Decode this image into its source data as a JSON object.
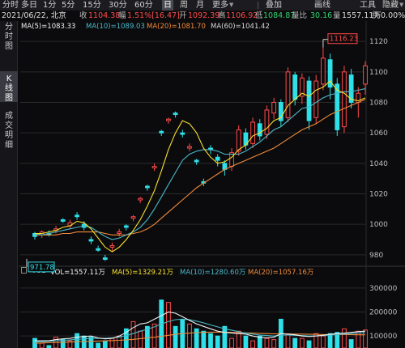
{
  "toolbar": {
    "items": [
      "分时",
      "多日",
      "1分",
      "5分",
      "15分",
      "30分",
      "60分",
      "日",
      "周",
      "月",
      "更多"
    ],
    "active_index": 7,
    "right_items": [
      "叠加",
      "画线",
      "工具",
      "隐藏"
    ]
  },
  "info": {
    "date_location": "2021/06/22, 北京",
    "close_label": "收",
    "close_value": "1104.38",
    "change_label": "幅",
    "change_value": "1.51%[16.47]",
    "open_label": "开",
    "open_value": "1092.39",
    "high_label": "高",
    "high_value": "1106.92",
    "low_label": "低",
    "low_value": "1084.87",
    "amp_label": "量比",
    "amp_value": "30.16",
    "amount_label": "量",
    "amount_value": "1557.11万",
    "turnover_label": "换",
    "turnover_value": "0.00%"
  },
  "sidebar": {
    "items": [
      "分时图",
      "K线图",
      "成交明细"
    ],
    "active_index": 1
  },
  "ma_legend": {
    "ma5": "MA(5)=1083.33",
    "ma10": "MA(10)=1089.03",
    "ma20": "MA(20)=1081.70",
    "ma60": "MA(60)=1041.42"
  },
  "vol_legend": {
    "vol_tag": "VOL",
    "vol": "VOL=1557.11万",
    "ma5": "MA(5)=1329.21万",
    "ma10": "MA(10)=1280.60万",
    "ma20": "MA(20)=1057.16万"
  },
  "colors": {
    "up": "#ff4a4a",
    "down": "#2ee0e8",
    "ma5": "#f0f0f0",
    "ma10": "#f7e12c",
    "ma20": "#4ab8c8",
    "ma60": "#f08a3a"
  },
  "chart_data": [
    {
      "type": "candlestick",
      "title": "",
      "y_ticks": [
        980,
        1000,
        1020,
        1040,
        1060,
        1080,
        1100,
        1120
      ],
      "ylim": [
        973,
        1127
      ],
      "annotations": [
        {
          "text": "1116.23",
          "kind": "high-marker"
        },
        {
          "text": "971.78",
          "kind": "low-marker"
        }
      ],
      "candles": [
        {
          "o": 994,
          "c": 992,
          "h": 995,
          "l": 990
        },
        {
          "o": 993,
          "c": 995,
          "h": 996,
          "l": 991
        },
        {
          "o": 994,
          "c": 993,
          "h": 996,
          "l": 992
        },
        {
          "o": 996,
          "c": 997,
          "h": 999,
          "l": 994
        },
        {
          "o": 1003,
          "c": 1002,
          "h": 1004,
          "l": 1001
        },
        {
          "o": 999,
          "c": 1001,
          "h": 1003,
          "l": 997
        },
        {
          "o": 1006,
          "c": 1005,
          "h": 1008,
          "l": 1003
        },
        {
          "o": 1000,
          "c": 998,
          "h": 1002,
          "l": 996
        },
        {
          "o": 990,
          "c": 989,
          "h": 992,
          "l": 987
        },
        {
          "o": 984,
          "c": 983,
          "h": 986,
          "l": 982
        },
        {
          "o": 978,
          "c": 977,
          "h": 980,
          "l": 976
        },
        {
          "o": 985,
          "c": 986,
          "h": 988,
          "l": 982
        },
        {
          "o": 994,
          "c": 995,
          "h": 997,
          "l": 992
        },
        {
          "o": 999,
          "c": 998,
          "h": 1000,
          "l": 996
        },
        {
          "o": 1004,
          "c": 1005,
          "h": 1006,
          "l": 1002
        },
        {
          "o": 1016,
          "c": 1017,
          "h": 1018,
          "l": 1014
        },
        {
          "o": 1025,
          "c": 1024,
          "h": 1026,
          "l": 1022
        },
        {
          "o": 1037,
          "c": 1038,
          "h": 1040,
          "l": 1035
        },
        {
          "o": 1061,
          "c": 1060,
          "h": 1062,
          "l": 1058
        },
        {
          "o": 1068,
          "c": 1069,
          "h": 1070,
          "l": 1066
        },
        {
          "o": 1073,
          "c": 1072,
          "h": 1074,
          "l": 1070
        },
        {
          "o": 1060,
          "c": 1059,
          "h": 1062,
          "l": 1057
        },
        {
          "o": 1050,
          "c": 1051,
          "h": 1053,
          "l": 1048
        },
        {
          "o": 1042,
          "c": 1041,
          "h": 1043,
          "l": 1039
        },
        {
          "o": 1028,
          "c": 1027,
          "h": 1030,
          "l": 1025
        },
        {
          "o": 1050,
          "c": 1049,
          "h": 1052,
          "l": 1046
        },
        {
          "o": 1044,
          "c": 1042,
          "h": 1046,
          "l": 1038
        },
        {
          "o": 1040,
          "c": 1036,
          "h": 1042,
          "l": 1032
        },
        {
          "o": 1038,
          "c": 1047,
          "h": 1050,
          "l": 1035
        },
        {
          "o": 1048,
          "c": 1062,
          "h": 1065,
          "l": 1045
        },
        {
          "o": 1060,
          "c": 1052,
          "h": 1063,
          "l": 1049
        },
        {
          "o": 1053,
          "c": 1067,
          "h": 1070,
          "l": 1050
        },
        {
          "o": 1066,
          "c": 1058,
          "h": 1069,
          "l": 1055
        },
        {
          "o": 1059,
          "c": 1075,
          "h": 1078,
          "l": 1056
        },
        {
          "o": 1073,
          "c": 1080,
          "h": 1083,
          "l": 1069
        },
        {
          "o": 1080,
          "c": 1068,
          "h": 1082,
          "l": 1064
        },
        {
          "o": 1070,
          "c": 1100,
          "h": 1103,
          "l": 1067
        },
        {
          "o": 1098,
          "c": 1082,
          "h": 1100,
          "l": 1078
        },
        {
          "o": 1084,
          "c": 1096,
          "h": 1099,
          "l": 1079
        },
        {
          "o": 1094,
          "c": 1068,
          "h": 1097,
          "l": 1062
        },
        {
          "o": 1070,
          "c": 1094,
          "h": 1098,
          "l": 1066
        },
        {
          "o": 1092,
          "c": 1109,
          "h": 1116,
          "l": 1088
        },
        {
          "o": 1108,
          "c": 1090,
          "h": 1112,
          "l": 1082
        },
        {
          "o": 1092,
          "c": 1062,
          "h": 1096,
          "l": 1058
        },
        {
          "o": 1064,
          "c": 1100,
          "h": 1104,
          "l": 1060
        },
        {
          "o": 1098,
          "c": 1080,
          "h": 1102,
          "l": 1076
        },
        {
          "o": 1080,
          "c": 1086,
          "h": 1090,
          "l": 1070
        },
        {
          "o": 1092,
          "c": 1104,
          "h": 1107,
          "l": 1085
        }
      ],
      "ma5": [
        994,
        994,
        995,
        996,
        998,
        999,
        1002,
        1001,
        997,
        991,
        985,
        982,
        985,
        990,
        996,
        1003,
        1012,
        1022,
        1035,
        1049,
        1060,
        1068,
        1066,
        1060,
        1050,
        1044,
        1040,
        1041,
        1044,
        1049,
        1052,
        1058,
        1060,
        1063,
        1068,
        1070,
        1078,
        1082,
        1086,
        1084,
        1088,
        1090,
        1094,
        1088,
        1086,
        1082,
        1081,
        1083
      ],
      "ma10": [
        994,
        993,
        994,
        995,
        996,
        997,
        998,
        999,
        998,
        995,
        992,
        990,
        991,
        993,
        995,
        998,
        1003,
        1010,
        1018,
        1026,
        1034,
        1042,
        1046,
        1048,
        1049,
        1049,
        1048,
        1046,
        1046,
        1046,
        1048,
        1051,
        1054,
        1058,
        1062,
        1064,
        1068,
        1072,
        1076,
        1077,
        1080,
        1083,
        1085,
        1086,
        1087,
        1087,
        1088,
        1089
      ],
      "ma20": [
        993,
        993,
        993,
        993,
        994,
        994,
        995,
        995,
        995,
        995,
        994,
        993,
        993,
        993,
        994,
        995,
        997,
        1000,
        1004,
        1008,
        1012,
        1016,
        1020,
        1024,
        1027,
        1030,
        1033,
        1036,
        1038,
        1040,
        1042,
        1044,
        1046,
        1048,
        1050,
        1053,
        1056,
        1059,
        1062,
        1064,
        1066,
        1069,
        1072,
        1074,
        1076,
        1078,
        1080,
        1082
      ]
    },
    {
      "type": "bar",
      "title": "",
      "y_ticks": [
        100000,
        200000,
        300000
      ],
      "ylim": [
        50000,
        340000
      ],
      "volumes": [
        90000,
        70000,
        60000,
        95000,
        85000,
        80000,
        110000,
        100000,
        95000,
        70000,
        80000,
        90000,
        100000,
        130000,
        160000,
        120000,
        140000,
        150000,
        250000,
        240000,
        140000,
        170000,
        150000,
        130000,
        120000,
        110000,
        100000,
        140000,
        90000,
        120000,
        100000,
        80000,
        100000,
        90000,
        85000,
        170000,
        105000,
        90000,
        90000,
        80000,
        110000,
        100000,
        110000,
        115000,
        130000,
        85000,
        120000,
        125000
      ],
      "vol_ma5": [
        80000,
        80000,
        80000,
        85000,
        88000,
        90000,
        95000,
        98000,
        100000,
        92000,
        88000,
        90000,
        100000,
        115000,
        135000,
        150000,
        155000,
        170000,
        185000,
        200000,
        195000,
        180000,
        165000,
        150000,
        140000,
        130000,
        120000,
        115000,
        112000,
        110000,
        108000,
        100000,
        95000,
        92000,
        95000,
        110000,
        108000,
        105000,
        100000,
        98000,
        100000,
        103000,
        107000,
        110000,
        112000,
        115000,
        118000,
        120000
      ],
      "vol_ma10": [
        75000,
        76000,
        78000,
        80000,
        82000,
        84000,
        86000,
        88000,
        90000,
        90000,
        90000,
        92000,
        96000,
        102000,
        110000,
        120000,
        128000,
        138000,
        150000,
        160000,
        168000,
        170000,
        168000,
        162000,
        155000,
        146000,
        138000,
        130000,
        124000,
        118000,
        112000,
        108000,
        104000,
        102000,
        100000,
        104000,
        104000,
        103000,
        102000,
        100000,
        101000,
        102000,
        104000,
        106000,
        108000,
        110000,
        112000,
        114000
      ],
      "vol_ma20": [
        70000,
        71000,
        72000,
        73000,
        74000,
        75000,
        76000,
        77000,
        78000,
        79000,
        80000,
        81000,
        82000,
        84000,
        86000,
        89000,
        92000,
        95000,
        99000,
        103000,
        107000,
        110000,
        112000,
        114000,
        115000,
        116000,
        116000,
        116000,
        115000,
        114000,
        113000,
        112000,
        111000,
        110000,
        109000,
        109000,
        109000,
        108000,
        108000,
        107000,
        107000,
        106000,
        106000,
        106000,
        106000,
        106000,
        105000,
        105000
      ]
    }
  ]
}
